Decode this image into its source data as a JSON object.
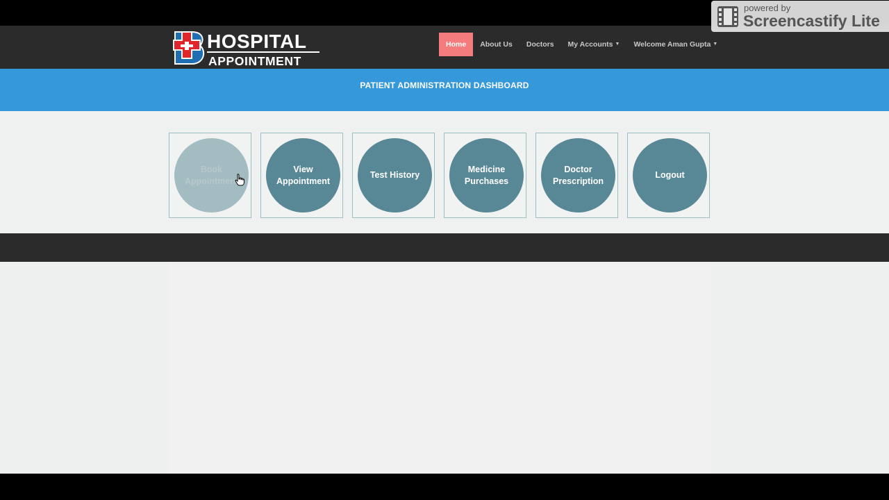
{
  "brand": {
    "line1": "HOSPITAL",
    "line2": "APPOINTMENT",
    "colors": {
      "red": "#e0262b",
      "blue": "#1f6fb5"
    }
  },
  "nav": {
    "items": [
      {
        "label": "Home",
        "active": true,
        "dropdown": false
      },
      {
        "label": "About Us",
        "active": false,
        "dropdown": false
      },
      {
        "label": "Doctors",
        "active": false,
        "dropdown": false
      },
      {
        "label": "My Accounts",
        "active": false,
        "dropdown": true
      },
      {
        "label": "Welcome Aman Gupta",
        "active": false,
        "dropdown": true
      }
    ],
    "active_color": "#f47c7c"
  },
  "watermark": {
    "line1": "powered by",
    "line2": "Screencastify Lite",
    "icon": "film-icon"
  },
  "banner": {
    "title": "PATIENT ADMINISTRATION DASHBOARD",
    "color": "#3498db"
  },
  "tiles": [
    {
      "label": "Book Appointment",
      "hovered": true
    },
    {
      "label": "View Appointment",
      "hovered": false
    },
    {
      "label": "Test History",
      "hovered": false
    },
    {
      "label": "Medicine Purchases",
      "hovered": false
    },
    {
      "label": "Doctor Prescription",
      "hovered": false
    },
    {
      "label": "Logout",
      "hovered": false
    }
  ],
  "tile_color": "#588896"
}
